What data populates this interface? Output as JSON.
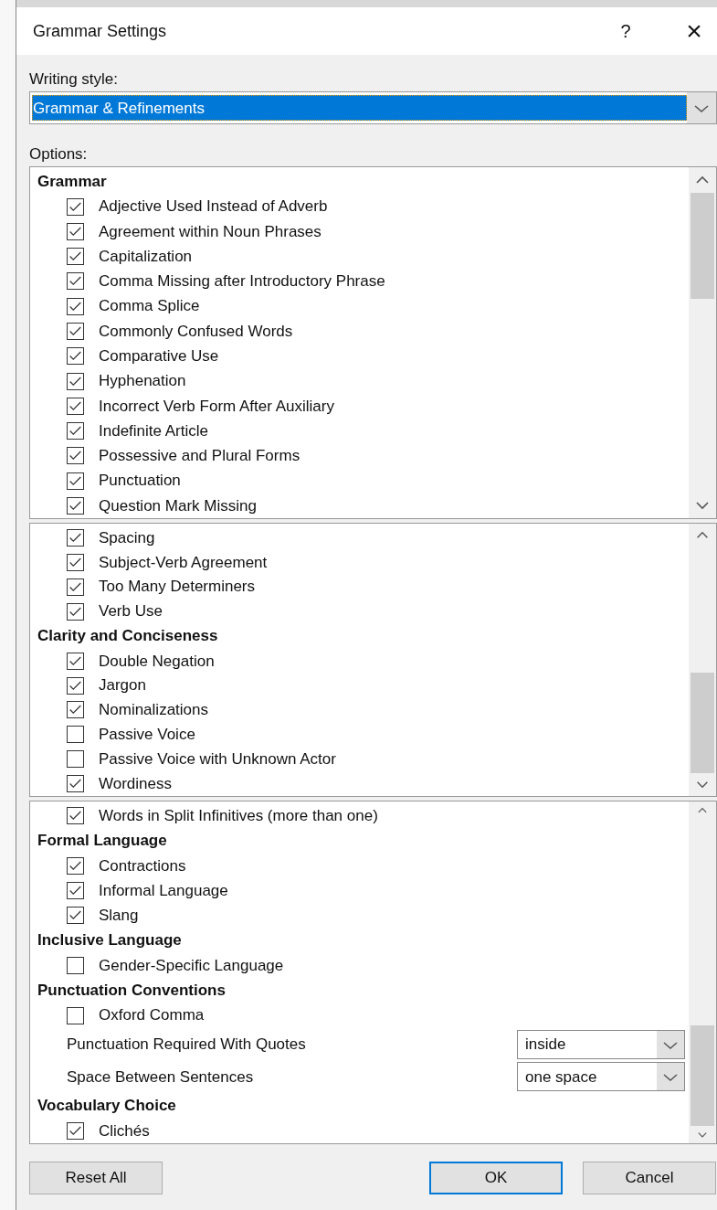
{
  "window": {
    "title": "Grammar Settings",
    "help": "?",
    "close": "×"
  },
  "writing_style": {
    "label": "Writing style:",
    "value": "Grammar & Refinements"
  },
  "options_label": "Options:",
  "panels": [
    {
      "items": [
        {
          "kind": "heading",
          "label": "Grammar"
        },
        {
          "kind": "check",
          "label": "Adjective Used Instead of Adverb",
          "checked": true
        },
        {
          "kind": "check",
          "label": "Agreement within Noun Phrases",
          "checked": true
        },
        {
          "kind": "check",
          "label": "Capitalization",
          "checked": true
        },
        {
          "kind": "check",
          "label": "Comma Missing after Introductory Phrase",
          "checked": true
        },
        {
          "kind": "check",
          "label": "Comma Splice",
          "checked": true
        },
        {
          "kind": "check",
          "label": "Commonly Confused Words",
          "checked": true
        },
        {
          "kind": "check",
          "label": "Comparative Use",
          "checked": true
        },
        {
          "kind": "check",
          "label": "Hyphenation",
          "checked": true
        },
        {
          "kind": "check",
          "label": "Incorrect Verb Form After Auxiliary",
          "checked": true
        },
        {
          "kind": "check",
          "label": "Indefinite Article",
          "checked": true
        },
        {
          "kind": "check",
          "label": "Possessive and Plural Forms",
          "checked": true
        },
        {
          "kind": "check",
          "label": "Punctuation",
          "checked": true
        },
        {
          "kind": "check",
          "label": "Question Mark Missing",
          "checked": true
        }
      ]
    },
    {
      "items": [
        {
          "kind": "check",
          "label": "Spacing",
          "checked": true
        },
        {
          "kind": "check",
          "label": "Subject-Verb Agreement",
          "checked": true
        },
        {
          "kind": "check",
          "label": "Too Many Determiners",
          "checked": true
        },
        {
          "kind": "check",
          "label": "Verb Use",
          "checked": true
        },
        {
          "kind": "heading",
          "label": "Clarity and Conciseness"
        },
        {
          "kind": "check",
          "label": "Double Negation",
          "checked": true
        },
        {
          "kind": "check",
          "label": "Jargon",
          "checked": true
        },
        {
          "kind": "check",
          "label": "Nominalizations",
          "checked": true
        },
        {
          "kind": "check",
          "label": "Passive Voice",
          "checked": false
        },
        {
          "kind": "check",
          "label": "Passive Voice with Unknown Actor",
          "checked": false
        },
        {
          "kind": "check",
          "label": "Wordiness",
          "checked": true
        }
      ]
    },
    {
      "items": [
        {
          "kind": "check",
          "label": "Words in Split Infinitives (more than one)",
          "checked": true
        },
        {
          "kind": "heading",
          "label": "Formal Language"
        },
        {
          "kind": "check",
          "label": "Contractions",
          "checked": true
        },
        {
          "kind": "check",
          "label": "Informal Language",
          "checked": true
        },
        {
          "kind": "check",
          "label": "Slang",
          "checked": true
        },
        {
          "kind": "heading",
          "label": "Inclusive Language"
        },
        {
          "kind": "check",
          "label": "Gender-Specific Language",
          "checked": false
        },
        {
          "kind": "heading",
          "label": "Punctuation Conventions"
        },
        {
          "kind": "check",
          "label": "Oxford Comma",
          "checked": false
        },
        {
          "kind": "dropdown",
          "label": "Punctuation Required With Quotes",
          "value": "inside"
        },
        {
          "kind": "dropdown",
          "label": "Space Between Sentences",
          "value": "one space"
        },
        {
          "kind": "heading",
          "label": "Vocabulary Choice"
        },
        {
          "kind": "check",
          "label": "Clichés",
          "checked": true
        }
      ]
    }
  ],
  "buttons": [
    {
      "label": "Reset All",
      "default": false
    },
    {
      "label": "OK",
      "default": true
    },
    {
      "label": "Cancel",
      "default": false
    }
  ]
}
